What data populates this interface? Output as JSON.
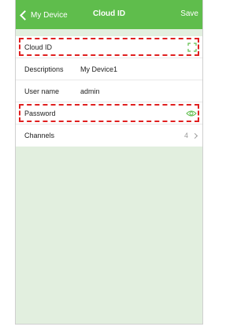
{
  "navbar": {
    "back_label": "My Device",
    "title": "Cloud ID",
    "save_label": "Save"
  },
  "rows": [
    {
      "label": "Cloud ID",
      "value": "",
      "icon": "qr-scan-icon",
      "highlighted": true
    },
    {
      "label": "Descriptions",
      "value": "My Device1"
    },
    {
      "label": "User name",
      "value": "admin"
    },
    {
      "label": "Password",
      "value": "",
      "icon": "eye-icon",
      "highlighted": true
    },
    {
      "label": "Channels",
      "value": "",
      "count": "4"
    }
  ],
  "colors": {
    "accent": "#5fbd4c",
    "highlight": "#e02020",
    "background": "#e2efdf"
  }
}
